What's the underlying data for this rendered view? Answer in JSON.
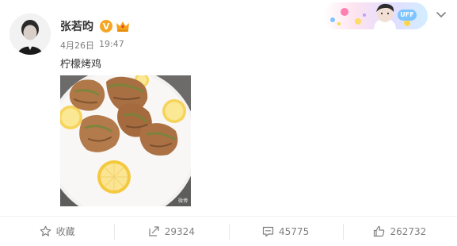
{
  "user": {
    "name": "张若昀",
    "verified_badge": "V",
    "avatar_icon": "avatar-photo",
    "vip_icon": "crown-icon"
  },
  "post": {
    "date": "4月26日",
    "time": "19:47",
    "text": "柠檬烤鸡",
    "photo_description_icon": "lemon-roast-chicken-photo",
    "photo_watermark": "微博"
  },
  "banner": {
    "badge_text": "UFF"
  },
  "actions": {
    "favorite_label": "收藏",
    "repost_count": "29324",
    "comment_count": "45775",
    "like_count": "262732"
  },
  "colors": {
    "verified_badge": "#f6a623",
    "crown": "#f4a21a",
    "action_text": "#808080",
    "text": "#333333"
  }
}
